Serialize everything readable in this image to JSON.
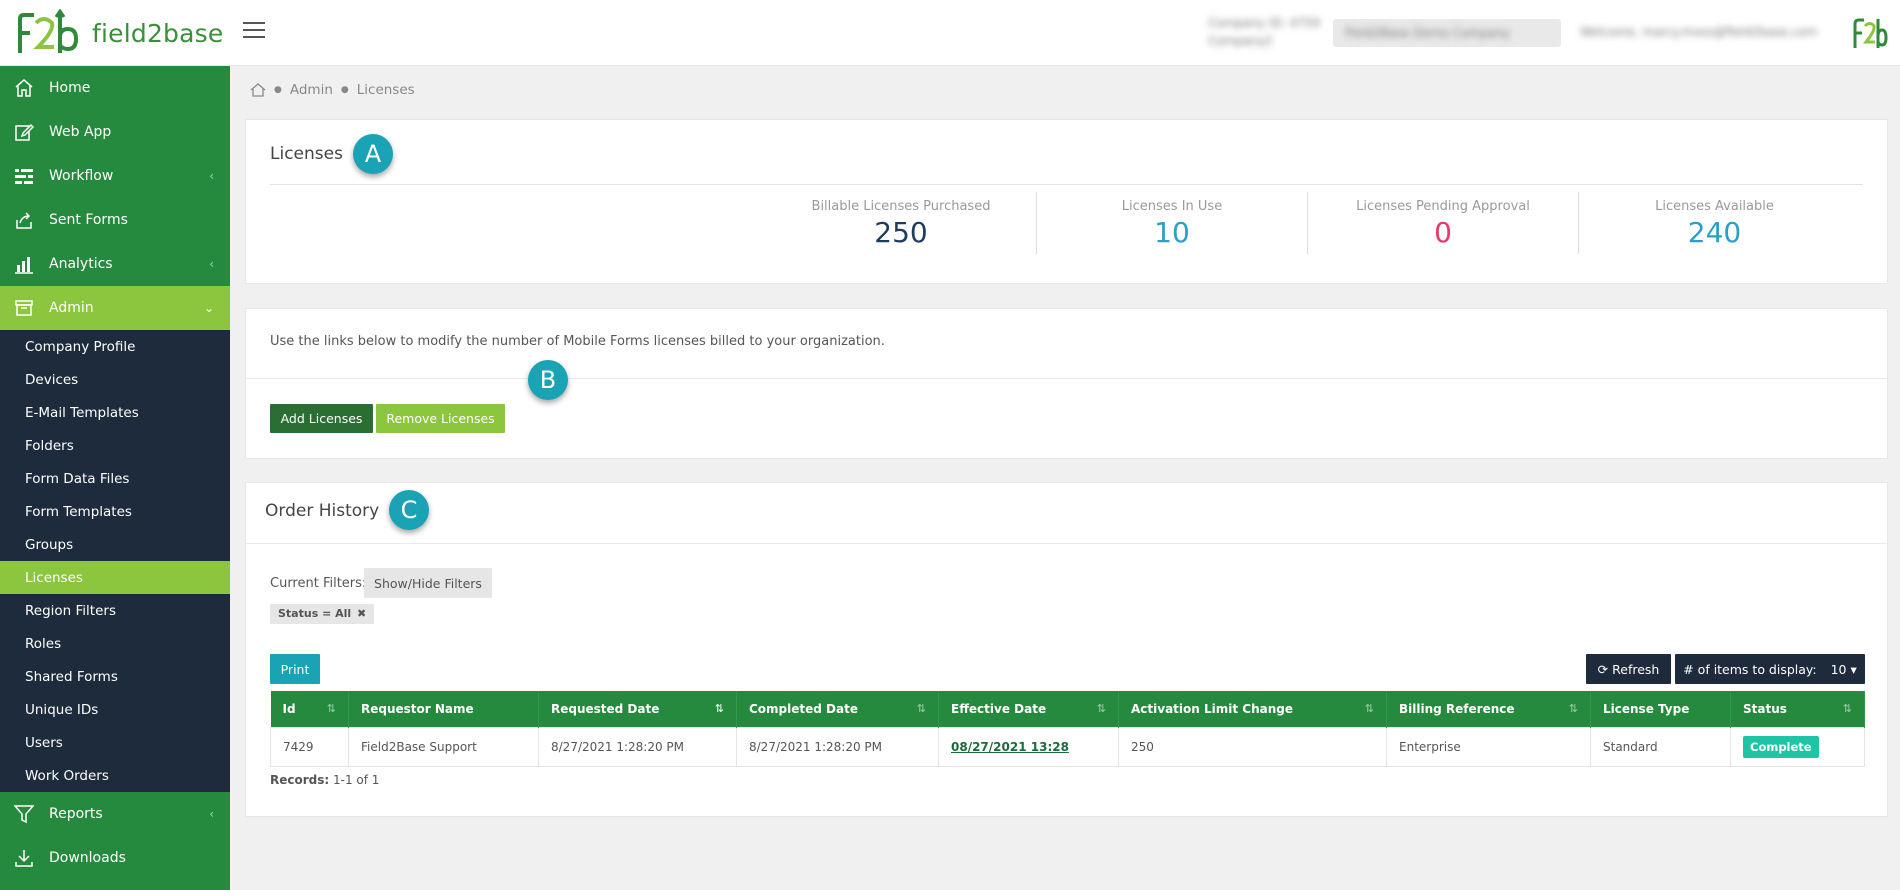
{
  "brand": {
    "name": "field2base"
  },
  "header": {
    "company_line1": "Company ID: 4759",
    "company_line2": "Company2",
    "company_select": "Field2Base Demo Company",
    "welcome": "Welcome, marcy.moss@field2base.com"
  },
  "sidebar": {
    "items": [
      {
        "label": "Home",
        "icon": "home-icon"
      },
      {
        "label": "Web App",
        "icon": "edit-icon"
      },
      {
        "label": "Workflow",
        "icon": "workflow-icon"
      },
      {
        "label": "Sent Forms",
        "icon": "share-icon"
      },
      {
        "label": "Analytics",
        "icon": "bar-chart-icon"
      },
      {
        "label": "Admin",
        "icon": "archive-icon"
      },
      {
        "label": "Reports",
        "icon": "filter-icon"
      },
      {
        "label": "Downloads",
        "icon": "download-icon"
      }
    ],
    "admin_submenu": [
      "Company Profile",
      "Devices",
      "E-Mail Templates",
      "Folders",
      "Form Data Files",
      "Form Templates",
      "Groups",
      "Licenses",
      "Region Filters",
      "Roles",
      "Shared Forms",
      "Unique IDs",
      "Users",
      "Work Orders"
    ]
  },
  "breadcrumb": {
    "items": [
      "Admin",
      "Licenses"
    ]
  },
  "licenses": {
    "title": "Licenses",
    "marker": "A",
    "stats": [
      {
        "label": "Billable Licenses Purchased",
        "value": "250",
        "color": "#1f3b5e"
      },
      {
        "label": "Licenses In Use",
        "value": "10",
        "color": "#2a9fc7"
      },
      {
        "label": "Licenses Pending Approval",
        "value": "0",
        "color": "#e8386a"
      },
      {
        "label": "Licenses Available",
        "value": "240",
        "color": "#2a9fc7"
      }
    ]
  },
  "modify": {
    "text": "Use the links below to modify the number of Mobile Forms licenses billed to your organization.",
    "marker": "B",
    "add_label": "Add Licenses",
    "remove_label": "Remove Licenses"
  },
  "history": {
    "title": "Order History",
    "marker": "C",
    "filters_label": "Current Filters:",
    "show_hide_label": "Show/Hide Filters",
    "filter_chip": "Status = All",
    "print_label": "Print",
    "refresh_label": "Refresh",
    "items_label": "# of items to display:",
    "items_value": "10",
    "columns": [
      "Id",
      "Requestor Name",
      "Requested Date",
      "Completed Date",
      "Effective Date",
      "Activation Limit Change",
      "Billing Reference",
      "License Type",
      "Status"
    ],
    "rows": [
      [
        "7429",
        "Field2Base Support",
        "8/27/2021 1:28:20 PM",
        "8/27/2021 1:28:20 PM",
        "08/27/2021 13:28",
        "250",
        "Enterprise",
        "Standard",
        "Complete"
      ]
    ],
    "records_label": "Records:",
    "records_value": "1-1 of 1"
  },
  "colors": {
    "sidebar_green": "#258a3d",
    "active_lime": "#8cc63f",
    "submenu_navy": "#1e2b3c",
    "marker_teal": "#1aa3b5"
  }
}
